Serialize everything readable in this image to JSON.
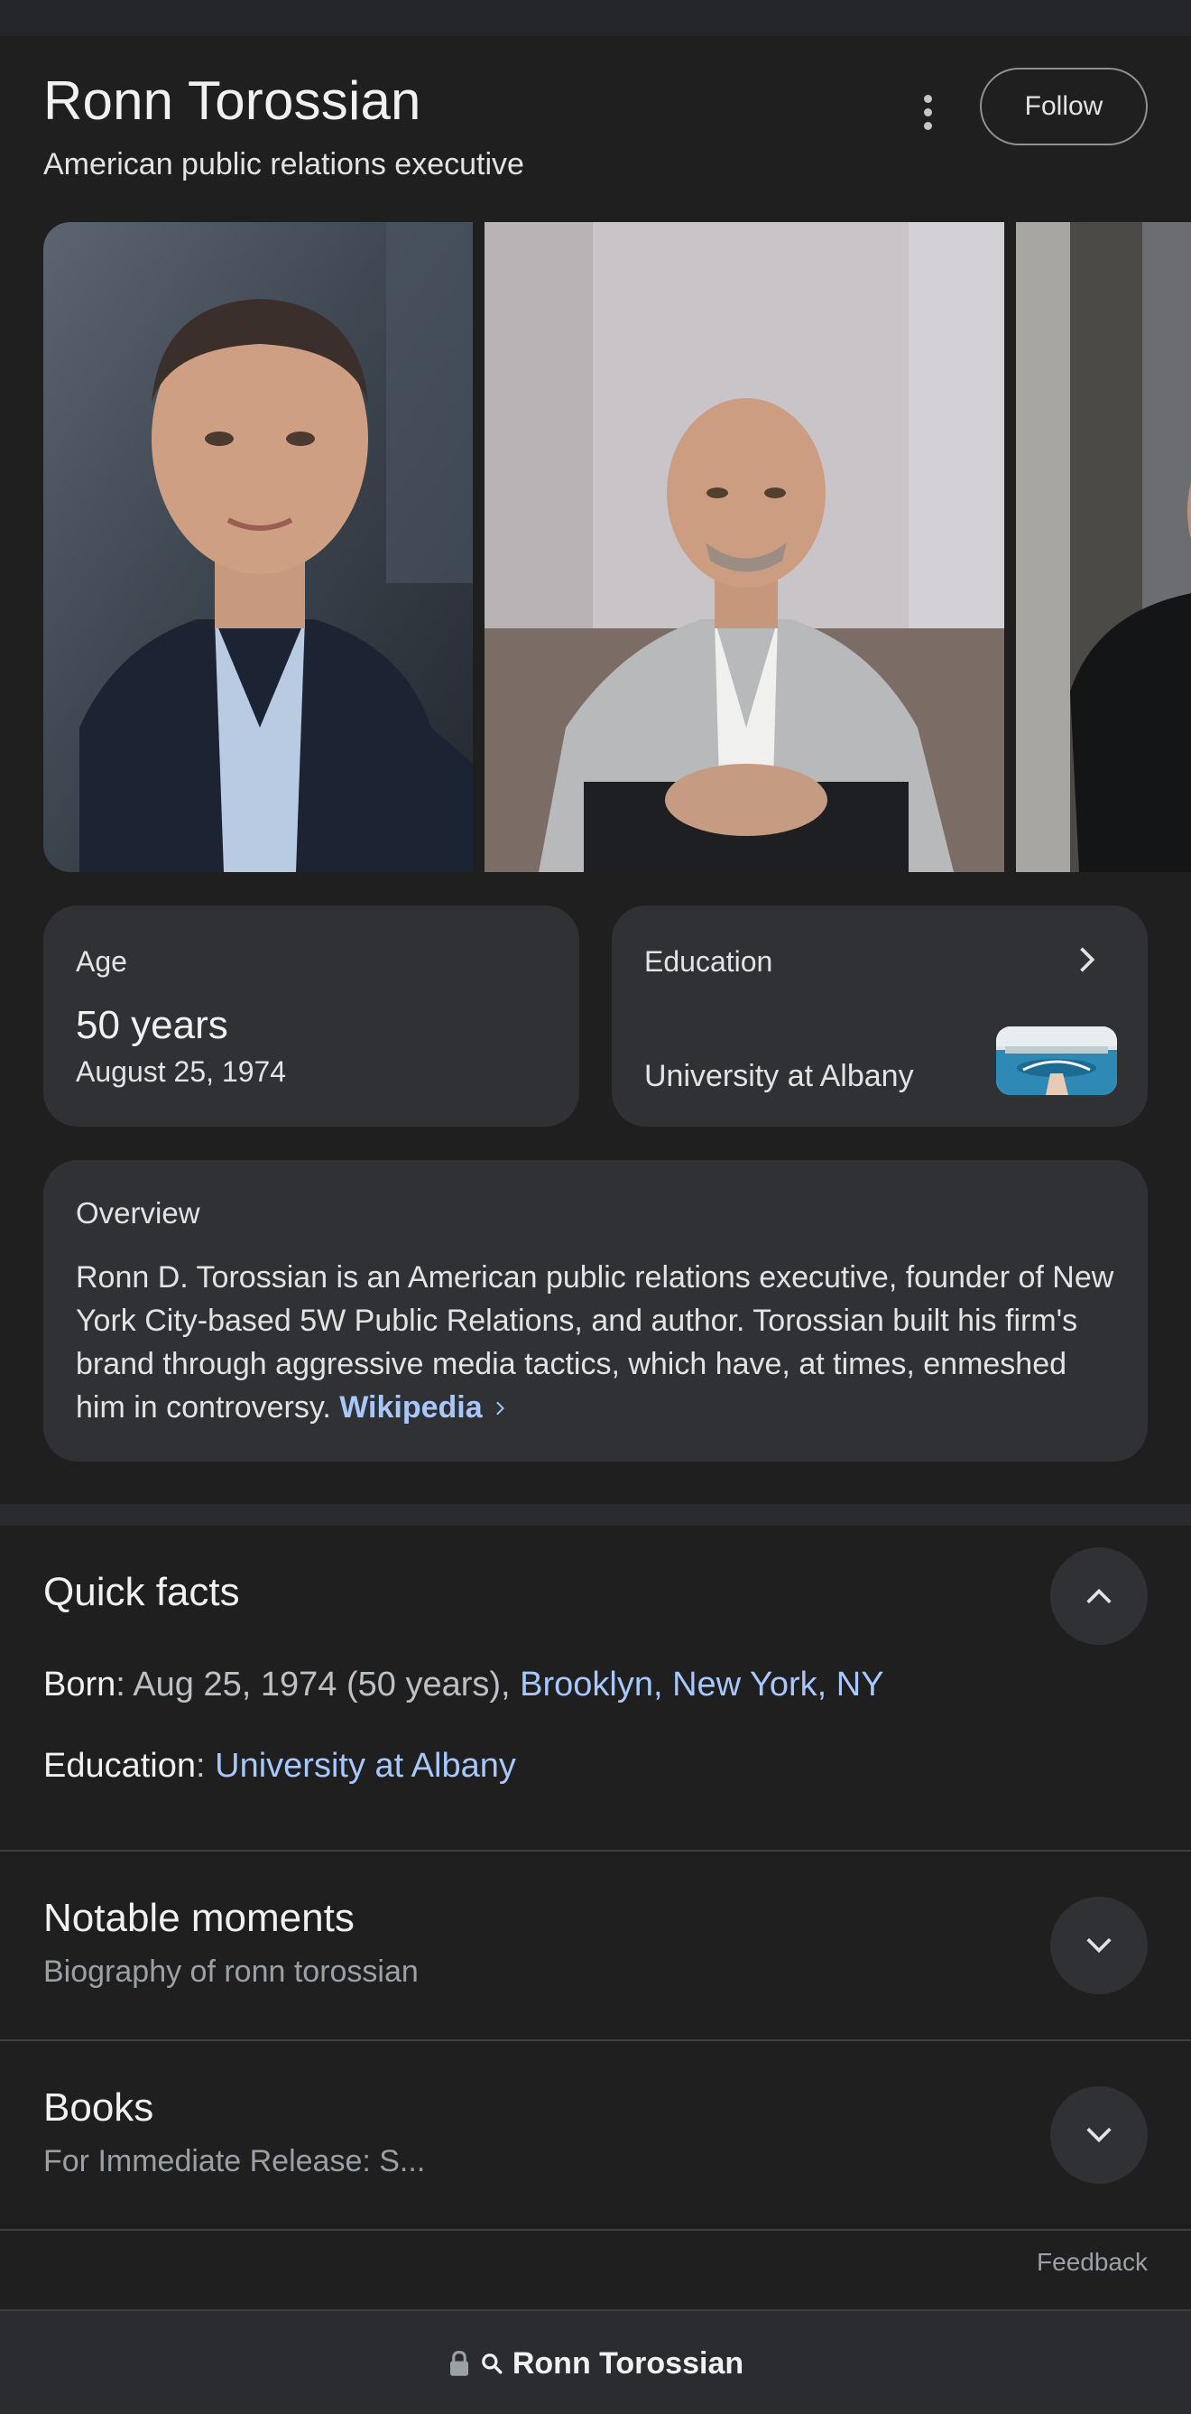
{
  "header": {
    "title": "Ronn Torossian",
    "subtitle": "American public relations executive",
    "follow_label": "Follow"
  },
  "gallery": {
    "images": [
      "photo-portrait-dark-suit",
      "photo-seated-grey-blazer",
      "photo-black-sweater-cropped"
    ]
  },
  "age_card": {
    "label": "Age",
    "value": "50 years",
    "date": "August 25, 1974"
  },
  "education_card": {
    "label": "Education",
    "value": "University at Albany",
    "icon": "chevron-right-icon"
  },
  "overview": {
    "title": "Overview",
    "text": "Ronn D. Torossian is an American public relations executive, founder of New York City-based 5W Public Relations, and author. Torossian built his firm's brand through aggressive media tactics, which have, at times, enmeshed him in controversy.",
    "source_label": "Wikipedia"
  },
  "quick_facts": {
    "title": "Quick facts",
    "born_key": "Born",
    "born_sep": ": ",
    "born_value": "Aug 25, 1974 (50 years), ",
    "born_link": "Brooklyn, New York, NY",
    "education_key": "Education",
    "education_sep": ": ",
    "education_link": "University at Albany"
  },
  "notable_moments": {
    "title": "Notable moments",
    "subtitle": "Biography of ronn torossian"
  },
  "books": {
    "title": "Books",
    "subtitle": "For Immediate Release: S..."
  },
  "footer": {
    "feedback_label": "Feedback"
  },
  "bottom_bar": {
    "query": "Ronn Torossian"
  },
  "colors": {
    "background": "#1f1f1f",
    "card": "#303134",
    "link": "#a8c7fa",
    "muted": "#9aa0a6"
  }
}
